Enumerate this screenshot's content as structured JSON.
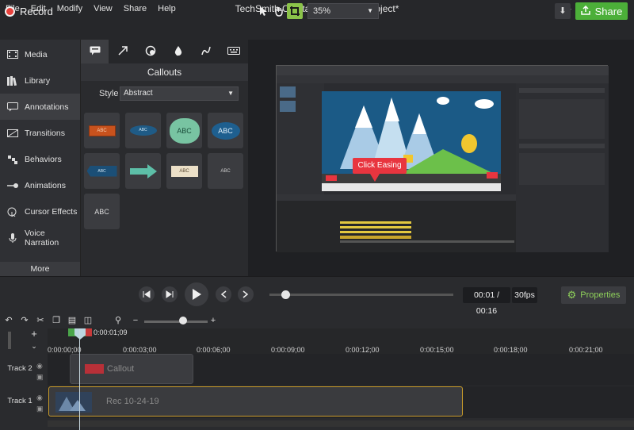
{
  "menu": {
    "items": [
      "File",
      "Edit",
      "Modify",
      "View",
      "Share",
      "Help"
    ],
    "title": "TechSmith Camtasia - Untitled Project*"
  },
  "toolbar": {
    "record_label": "Record",
    "zoom_value": "35%",
    "share_label": "Share"
  },
  "leftnav": {
    "items": [
      "Media",
      "Library",
      "Annotations",
      "Transitions",
      "Behaviors",
      "Animations",
      "Cursor Effects",
      "Voice Narration"
    ],
    "more_label": "More"
  },
  "toolpanel": {
    "title": "Callouts",
    "style_label": "Style",
    "style_value": "Abstract",
    "thumbs": [
      "ABC",
      "ABC",
      "ABC",
      "ABC",
      "ABC",
      "",
      "ABC",
      "ABC",
      "ABC"
    ]
  },
  "canvas": {
    "callout_text": "Click Easing"
  },
  "playback": {
    "time": "00:01 / 00:16",
    "fps": "30fps",
    "properties_label": "Properties"
  },
  "timeline": {
    "playhead_time": "0:00:01;09",
    "ticks": [
      "0:00:00;00",
      "0:00:03;00",
      "0:00:06;00",
      "0:00:09;00",
      "0:00:12;00",
      "0:00:15;00",
      "0:00:18;00",
      "0:00:21;00"
    ],
    "tracks": [
      {
        "label": "Track 2",
        "clip": "Callout"
      },
      {
        "label": "Track 1",
        "clip": "Rec 10-24-19"
      }
    ]
  },
  "colors": {
    "record": "#e8413c",
    "share": "#4caf39",
    "properties_icon": "#8ed05a",
    "clip_selected_border": "#c89b2a",
    "callout_red": "#e8353f"
  }
}
